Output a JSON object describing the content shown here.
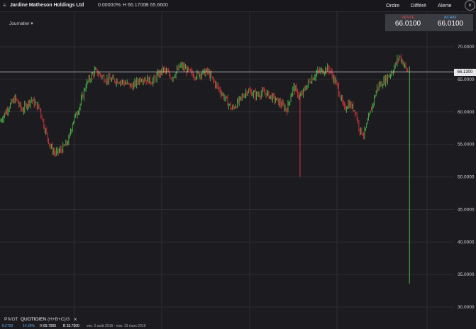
{
  "header": {
    "title": "Jardine Matheson Holdings Ltd",
    "change": "0.0000",
    "change_pct": "0%",
    "high": "H 66.1700",
    "low": "B 65.6600",
    "actions": [
      "Ordre",
      "Différé",
      "Alerte"
    ]
  },
  "interval": {
    "label": "Journalier"
  },
  "quote": {
    "sell_label": "VENTE",
    "sell_value": "66.0100",
    "buy_label": "ACHAT",
    "buy_value": "66.0100",
    "sell_color": "#e24b55",
    "buy_color": "#5aa6e8"
  },
  "current_price": "66.1300",
  "y_axis": {
    "min": 30,
    "max": 70,
    "ticks": [
      "70.0000",
      "65.0000",
      "60.0000",
      "55.0000",
      "50.0000",
      "45.0000",
      "40.0000",
      "35.0000",
      "30.0000"
    ]
  },
  "footer": {
    "indicator": "PIVOT",
    "period": "QUOTIDIEN",
    "formula": "(H+B+C)/3",
    "close_symbol": "×",
    "pct_a": "8.2700",
    "pct_b": "14.29%",
    "high": "H 69.7900",
    "low": "B 33.7500",
    "range": "ven. 5 août 2016 - mar. 19 mars 2019"
  },
  "colors": {
    "up": "#4fb848",
    "down": "#d8343c",
    "background": "#1c1c20",
    "grid": "#2c2c32"
  },
  "chart_data": {
    "type": "line",
    "x_range": [
      "2016-08-05",
      "2019-03-19"
    ],
    "ylim": [
      30,
      70
    ],
    "points": [
      [
        0,
        58.5
      ],
      [
        0.02,
        60.8
      ],
      [
        0.035,
        62.1
      ],
      [
        0.05,
        60.2
      ],
      [
        0.07,
        61.9
      ],
      [
        0.09,
        60.5
      ],
      [
        0.1,
        57.8
      ],
      [
        0.115,
        54.5
      ],
      [
        0.125,
        53.6
      ],
      [
        0.14,
        54.2
      ],
      [
        0.155,
        55.5
      ],
      [
        0.165,
        58.5
      ],
      [
        0.18,
        60.8
      ],
      [
        0.195,
        64.2
      ],
      [
        0.215,
        66.3
      ],
      [
        0.24,
        65.0
      ],
      [
        0.27,
        64.8
      ],
      [
        0.3,
        63.9
      ],
      [
        0.32,
        65.2
      ],
      [
        0.345,
        64.7
      ],
      [
        0.37,
        66.5
      ],
      [
        0.39,
        65.3
      ],
      [
        0.41,
        67.1
      ],
      [
        0.44,
        65.6
      ],
      [
        0.47,
        66.2
      ],
      [
        0.49,
        64.1
      ],
      [
        0.51,
        62.1
      ],
      [
        0.525,
        60.4
      ],
      [
        0.54,
        61.5
      ],
      [
        0.56,
        63.3
      ],
      [
        0.58,
        62.6
      ],
      [
        0.6,
        63.0
      ],
      [
        0.63,
        61.6
      ],
      [
        0.65,
        60.3
      ],
      [
        0.665,
        63.9
      ],
      [
        0.68,
        62.2
      ],
      [
        0.7,
        64.6
      ],
      [
        0.72,
        66.1
      ],
      [
        0.745,
        66.7
      ],
      [
        0.765,
        63.9
      ],
      [
        0.78,
        60.4
      ],
      [
        0.79,
        61.3
      ],
      [
        0.805,
        60.2
      ],
      [
        0.815,
        57.3
      ],
      [
        0.825,
        56.5
      ],
      [
        0.84,
        60.1
      ],
      [
        0.855,
        63.8
      ],
      [
        0.87,
        64.7
      ],
      [
        0.89,
        66.3
      ],
      [
        0.905,
        68.6
      ],
      [
        0.915,
        67.4
      ],
      [
        0.925,
        66.0
      ]
    ],
    "spikes": [
      {
        "x": 0.68,
        "low": 50.0,
        "color": "down"
      },
      {
        "x": 0.928,
        "low": 33.6,
        "color": "up"
      }
    ]
  }
}
